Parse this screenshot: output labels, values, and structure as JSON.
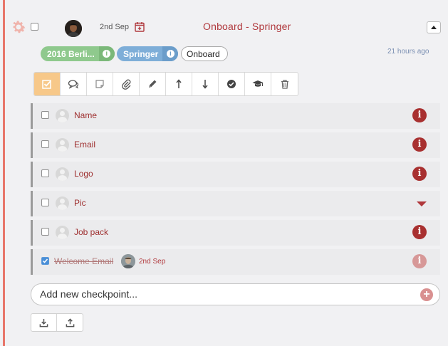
{
  "card": {
    "date": "2nd Sep",
    "title": "Onboard - Springer",
    "time_ago": "21 hours ago",
    "tags": [
      {
        "label": "2016 Berli..."
      },
      {
        "label": "Springer"
      },
      {
        "label": "Onboard"
      }
    ]
  },
  "toolbar": {
    "buttons": [
      "checklist-icon",
      "comments-icon",
      "note-icon",
      "attachment-icon",
      "edit-icon",
      "move-up-icon",
      "move-down-icon",
      "complete-icon",
      "graduation-cap-icon",
      "trash-icon"
    ]
  },
  "checkpoints": [
    {
      "label": "Name",
      "checked": false
    },
    {
      "label": "Email",
      "checked": false
    },
    {
      "label": "Logo",
      "checked": false
    },
    {
      "label": "Pic",
      "checked": false
    },
    {
      "label": "Job pack",
      "checked": false
    },
    {
      "label": "Welcome Email",
      "checked": true,
      "date": "2nd Sep"
    }
  ],
  "add_checkpoint": {
    "placeholder": "Add new checkpoint..."
  },
  "colors": {
    "accent_red": "#b0383c",
    "left_bar": "#e8766a",
    "tag_green": "#8fc98d",
    "tag_blue": "#7eaed8",
    "toolbar_active": "#f7c889"
  }
}
